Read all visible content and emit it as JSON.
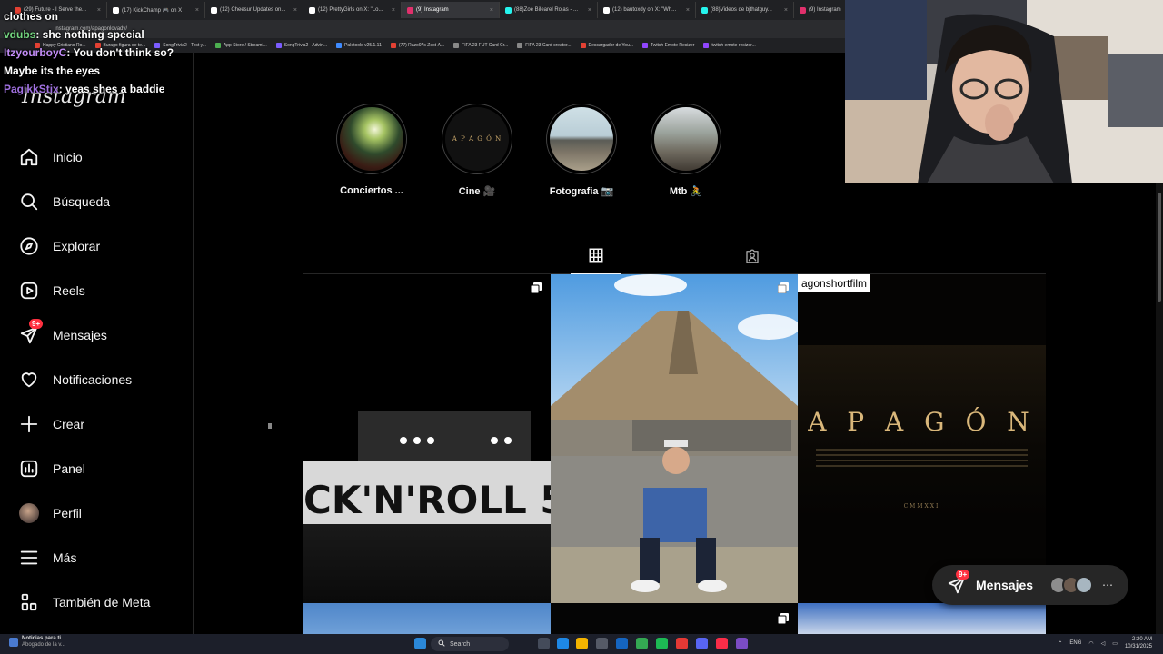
{
  "browser": {
    "tabs": [
      {
        "label": "(29) Future - I Serve the...",
        "color": "#e34133"
      },
      {
        "label": "(17) KickChamp 🎮 on X",
        "color": "#ffffff"
      },
      {
        "label": "(12) Cheesur Updates on...",
        "color": "#ffffff"
      },
      {
        "label": "(12) PrettyGirls on X: \"Lo...",
        "color": "#ffffff"
      },
      {
        "label": "(9) Instagram",
        "color": "#e1306c"
      },
      {
        "label": "(88)Zoé Bilearel Rojas - ...",
        "color": "#25f4ee"
      },
      {
        "label": "(12) bautoxdy on X: \"Wh...",
        "color": "#ffffff"
      },
      {
        "label": "(88)Videos de bjthatguy...",
        "color": "#25f4ee"
      },
      {
        "label": "(9) Instagram",
        "color": "#e1306c"
      }
    ],
    "url": "instagram.com/apagonlovady/",
    "bookmarks": [
      {
        "label": "Happy Cristiano Ro...",
        "color": "#e34133"
      },
      {
        "label": "Burago figura de te...",
        "color": "#e34133"
      },
      {
        "label": "SongTrivia2 - Test y...",
        "color": "#7b5cff"
      },
      {
        "label": "App Store / Streami...",
        "color": "#4caf50"
      },
      {
        "label": "SongTrivia2 - Advin...",
        "color": "#7b5cff"
      },
      {
        "label": "Paletools v25.1.11",
        "color": "#3f8bff"
      },
      {
        "label": "(77) Razo97s Zest-A...",
        "color": "#e34133"
      },
      {
        "label": "FIFA 23 FUT Card Cr...",
        "color": "#888888"
      },
      {
        "label": "FIFA 23 Card creator...",
        "color": "#888888"
      },
      {
        "label": "Descargador de You...",
        "color": "#e34133"
      },
      {
        "label": "Twitch Emote Resizer",
        "color": "#9146ff"
      },
      {
        "label": "twitch emote resizer...",
        "color": "#9146ff"
      }
    ]
  },
  "chat": {
    "line0": "clothes on",
    "msg1_user": "vdubs",
    "msg1_text": ": she nothing special",
    "msg2_user": "ItzyourboyC",
    "msg2_text": ": You don't think so?",
    "line3": "Maybe its the eyes",
    "msg4_user": "PagikkStix",
    "msg4_text": ": yeas shes a baddie"
  },
  "sidebar": {
    "logo": "Instagram",
    "items": [
      {
        "label": "Inicio",
        "icon": "home-icon"
      },
      {
        "label": "Búsqueda",
        "icon": "search-icon"
      },
      {
        "label": "Explorar",
        "icon": "compass-icon"
      },
      {
        "label": "Reels",
        "icon": "reels-icon"
      },
      {
        "label": "Mensajes",
        "icon": "messenger-icon",
        "badge": "9+"
      },
      {
        "label": "Notificaciones",
        "icon": "heart-icon"
      },
      {
        "label": "Crear",
        "icon": "plus-icon"
      },
      {
        "label": "Panel",
        "icon": "chart-icon"
      },
      {
        "label": "Perfil",
        "icon": "avatar"
      },
      {
        "label": "Más",
        "icon": "menu-icon"
      },
      {
        "label": "También de Meta",
        "icon": "meta-apps-icon"
      }
    ]
  },
  "highlights": [
    {
      "label": "Conciertos ..."
    },
    {
      "label": "Cine 🎥"
    },
    {
      "label": "Fotografia 📷"
    },
    {
      "label": "Mtb 🚴"
    }
  ],
  "poster": {
    "title": "A P A G Ó N",
    "year": "CMMXXI",
    "concert_text": "CK'N'ROLL 5"
  },
  "tooltip": "agonshortfilm",
  "messages_pill": {
    "label": "Mensajes",
    "badge": "9+"
  },
  "taskbar": {
    "news_title": "Noticias para ti",
    "news_sub": "Abogado de la v...",
    "search": "Search",
    "lang": "ENG",
    "time": "2:20 AM",
    "date": "10/31/2025"
  },
  "colors": {
    "ig_badge": "#ff3040",
    "background": "#000000",
    "border": "#262626"
  }
}
